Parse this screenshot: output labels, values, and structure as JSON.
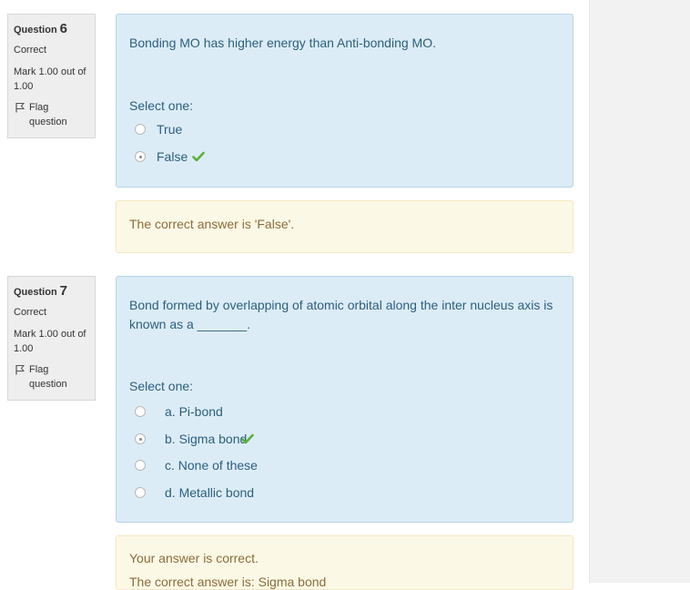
{
  "questions": [
    {
      "label": "Question",
      "number": "6",
      "state": "Correct",
      "grade": "Mark 1.00 out of 1.00",
      "flag_label": "Flag question",
      "text": "Bonding MO has higher energy than Anti-bonding MO.",
      "prompt": "Select one:",
      "options": [
        {
          "label": "True",
          "selected": false
        },
        {
          "label": "False",
          "selected": true,
          "correct_mark": true
        }
      ],
      "feedback": [
        "The correct answer is 'False'."
      ]
    },
    {
      "label": "Question",
      "number": "7",
      "state": "Correct",
      "grade": "Mark 1.00 out of 1.00",
      "flag_label": "Flag question",
      "text": "Bond formed by overlapping of atomic orbital along the inter nucleus axis is known as a _______.",
      "prompt": "Select one:",
      "options": [
        {
          "label": "a. Pi-bond",
          "selected": false
        },
        {
          "label": "b. Sigma bond",
          "selected": true,
          "correct_mark": true
        },
        {
          "label": "c. None of these",
          "selected": false
        },
        {
          "label": "d. Metallic bond",
          "selected": false
        }
      ],
      "feedback": [
        "Your answer is correct.",
        "The correct answer is: Sigma bond"
      ]
    }
  ],
  "icons": {
    "flag": "flag-icon",
    "tick": "check-icon",
    "radio": "radio-button"
  },
  "colors": {
    "question_bg": "#dcecf6",
    "feedback_bg": "#fcf8e6",
    "tick": "#5bb135"
  }
}
